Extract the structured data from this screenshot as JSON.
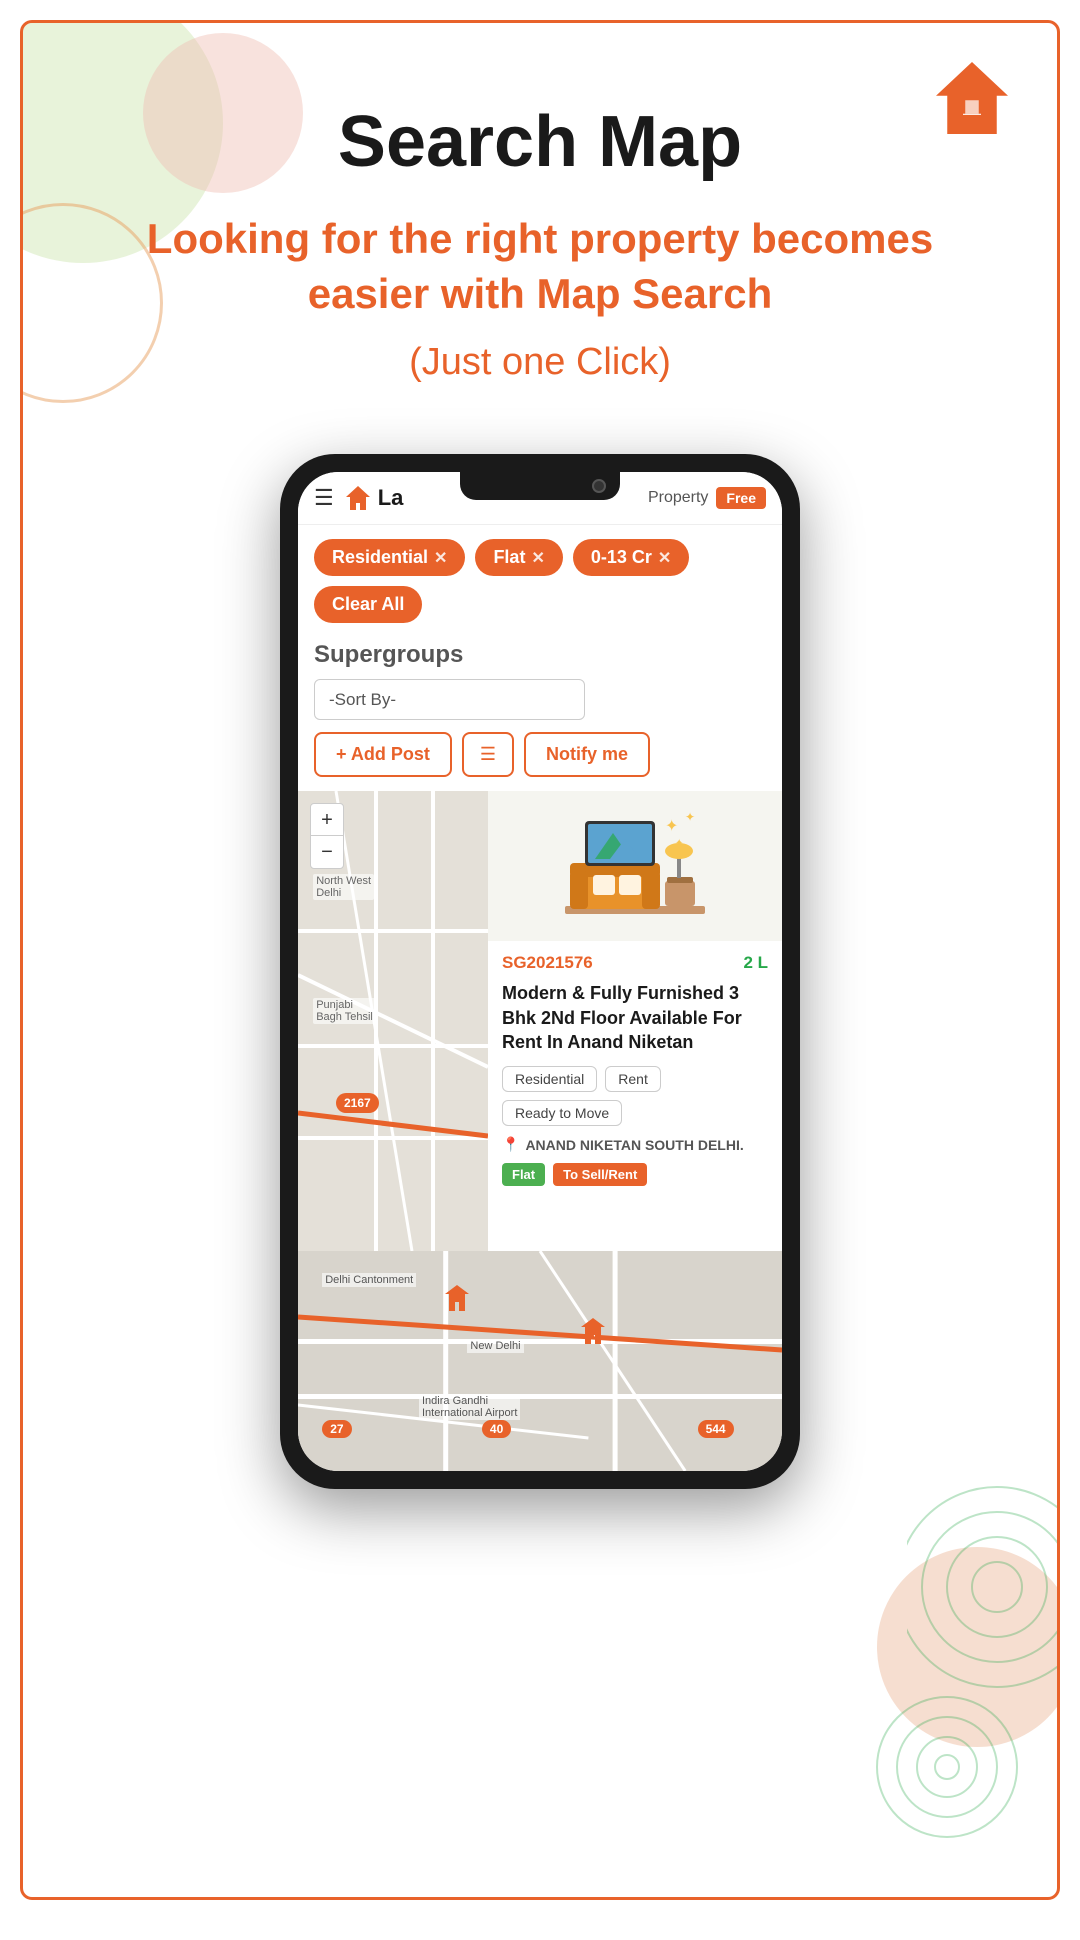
{
  "page": {
    "border_color": "#e8622a",
    "background": "#fff"
  },
  "header": {
    "title": "Search Map",
    "subtitle": "Looking for the right property becomes easier with Map Search",
    "tagline": "(Just one Click)"
  },
  "app_bar": {
    "logo_text": "La",
    "property_label": "Property",
    "free_badge": "Free"
  },
  "filter_chips": [
    {
      "label": "Residential",
      "removable": true
    },
    {
      "label": "Flat",
      "removable": true
    },
    {
      "label": "0-13 Cr",
      "removable": true
    }
  ],
  "clear_all_label": "Clear All",
  "supergroups_label": "Supergroups",
  "sort_by": {
    "label": "-Sort By-",
    "placeholder": "-Sort By-"
  },
  "action_buttons": {
    "add_post": "+ Add Post",
    "list_icon": "☰",
    "notify": "Notify me"
  },
  "map_controls": {
    "zoom_in": "+",
    "zoom_out": "−"
  },
  "listing": {
    "id": "SG2021576",
    "price": "2 L",
    "title": "Modern & Fully Furnished 3 Bhk 2Nd Floor Available For Rent In Anand Niketan",
    "tags": [
      "Residential",
      "Rent",
      "Ready to Move"
    ],
    "location": "ANAND NIKETAN SOUTH DELHI.",
    "tag_flat": "Flat",
    "tag_sell_rent": "To Sell/Rent"
  },
  "map_numbers": [
    "2167",
    "27",
    "40",
    "544"
  ],
  "map_labels": [
    "North West Delhi",
    "Punjabi Bagh Tehsil",
    "New Delhi",
    "Indira Gandhi International Airport"
  ],
  "colors": {
    "accent": "#e8622a",
    "green": "#27a84a",
    "tag_green": "#4caf50"
  }
}
